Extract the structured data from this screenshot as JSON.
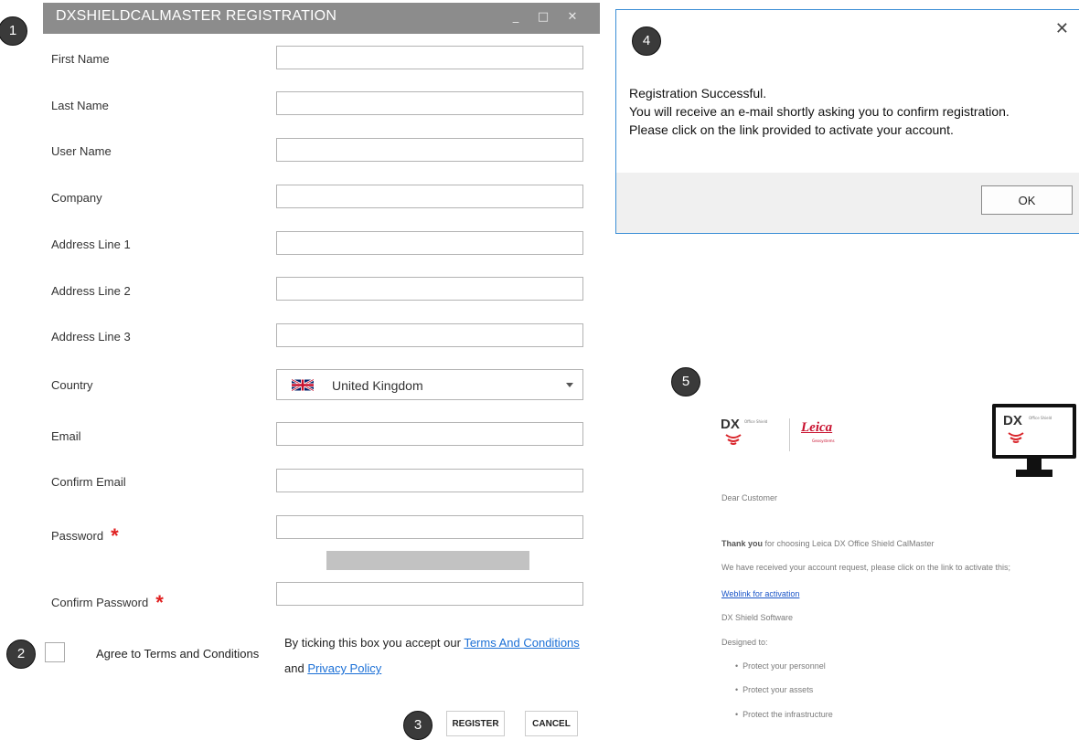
{
  "badges": [
    "1",
    "2",
    "3",
    "4",
    "5"
  ],
  "window": {
    "title": "DXSHIELDCALMASTER REGISTRATION",
    "controls": {
      "minimize": "_",
      "maximize": "□",
      "close": "✕"
    }
  },
  "form": {
    "first_name": "First Name",
    "last_name": "Last Name",
    "user_name": "User Name",
    "company": "Company",
    "address1": "Address Line 1",
    "address2": "Address Line 2",
    "address3": "Address Line 3",
    "country": "Country",
    "email": "Email",
    "confirm_email": "Confirm Email",
    "password": "Password",
    "confirm_password": "Confirm Password",
    "required_mark": "*",
    "country_value": "United Kingdom",
    "country_flag_icon": "uk-flag-icon"
  },
  "terms": {
    "agree_label": "Agree to Terms and Conditions",
    "line1_prefix": "By ticking this box you accept our",
    "terms_link": "Terms And Conditions",
    "line2_prefix": "and",
    "privacy_link": "Privacy Policy"
  },
  "buttons": {
    "register": "REGISTER",
    "cancel": "CANCEL"
  },
  "message_box": {
    "close": "✕",
    "line1": "Registration Successful.",
    "line2": "You will receive an e-mail shortly asking you to confirm registration.",
    "line3": "Please click on the link provided to activate your account.",
    "ok": "OK"
  },
  "email": {
    "dx_logo": "DX",
    "dx_tag": "Office Shield",
    "leica_logo": "Leica",
    "leica_sub": "Geosystems",
    "monitor_logo": "DX",
    "monitor_tag": "Office Shield",
    "greeting": "Dear Customer",
    "thank_bold": "Thank you",
    "thank_rest": "for choosing Leica DX Office Shield CalMaster",
    "received": "We have received your account request, please click on the link to activate this;",
    "weblink": "Weblink for activation",
    "software": "DX Shield Software",
    "designed": "Designed to:",
    "bullets": [
      "Protect your personnel",
      "Protect your assets",
      "Protect the infrastructure"
    ]
  },
  "colors": {
    "titlebar": "#8c8c8c",
    "link": "#1a6fd6",
    "required": "#e02020",
    "dx_red": "#d9262c",
    "msgbox_border": "#3c8fd6"
  }
}
